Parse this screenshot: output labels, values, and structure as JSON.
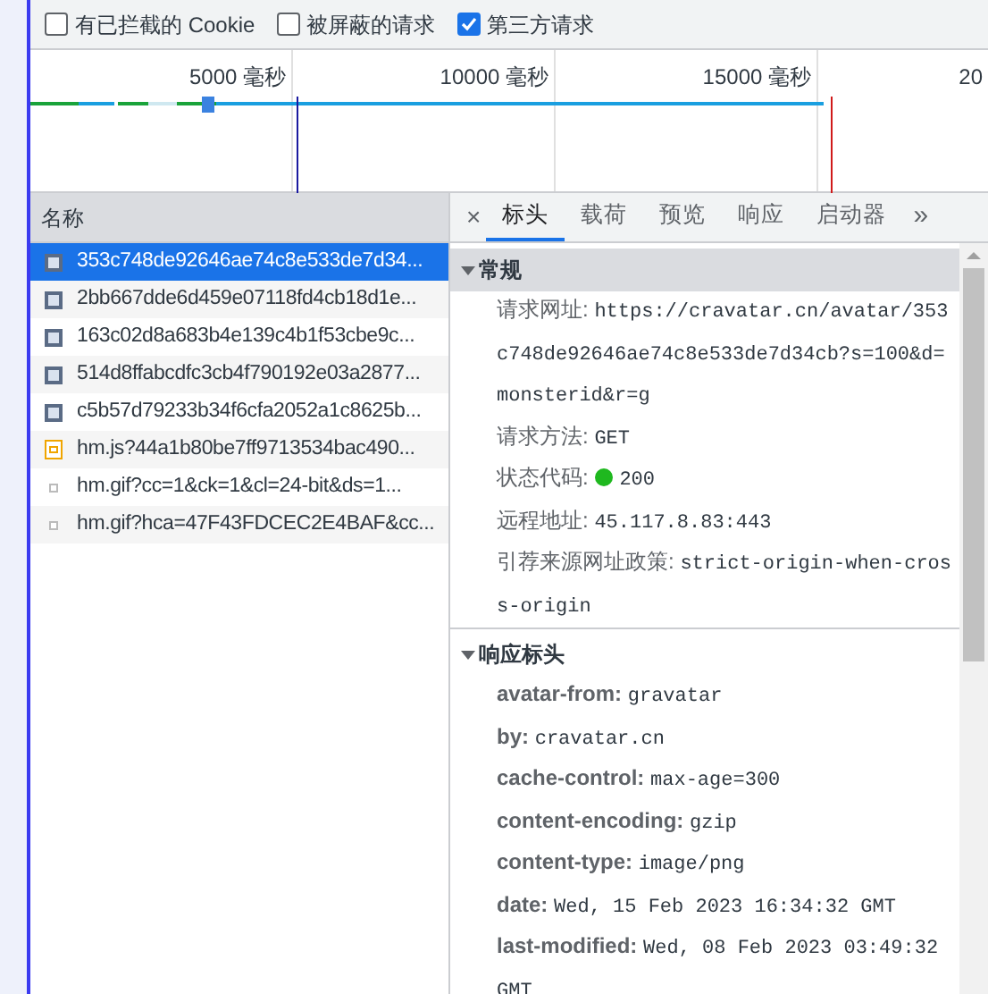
{
  "filters": [
    {
      "label": "有已拦截的 Cookie",
      "checked": false
    },
    {
      "label": "被屏蔽的请求",
      "checked": false
    },
    {
      "label": "第三方请求",
      "checked": true
    }
  ],
  "timeline": {
    "ticks": [
      "5000 毫秒",
      "10000 毫秒",
      "15000 毫秒",
      "20"
    ]
  },
  "request_list": {
    "header": "名称",
    "rows": [
      {
        "name": "353c748de92646ae74c8e533de7d34...",
        "kind": "image",
        "selected": true
      },
      {
        "name": "2bb667dde6d459e07118fd4cb18d1e...",
        "kind": "image",
        "selected": false
      },
      {
        "name": "163c02d8a683b4e139c4b1f53cbe9c...",
        "kind": "image",
        "selected": false
      },
      {
        "name": "514d8ffabcdfc3cb4f790192e03a2877...",
        "kind": "image",
        "selected": false
      },
      {
        "name": "c5b57d79233b34f6cfa2052a1c8625b...",
        "kind": "image",
        "selected": false
      },
      {
        "name": "hm.js?44a1b80be7ff9713534bac490...",
        "kind": "script",
        "selected": false
      },
      {
        "name": "hm.gif?cc=1&ck=1&cl=24-bit&ds=1...",
        "kind": "gif",
        "selected": false
      },
      {
        "name": "hm.gif?hca=47F43FDCEC2E4BAF&cc...",
        "kind": "gif",
        "selected": false
      }
    ]
  },
  "detail": {
    "close": "×",
    "more": "»",
    "tabs": [
      {
        "label": "标头",
        "selected": true
      },
      {
        "label": "载荷",
        "selected": false
      },
      {
        "label": "预览",
        "selected": false
      },
      {
        "label": "响应",
        "selected": false
      },
      {
        "label": "启动器",
        "selected": false
      }
    ],
    "sections": [
      {
        "title": "常规",
        "expanded": true,
        "rows": [
          {
            "key": "请求网址:",
            "value": "https://cravatar.cn/avatar/353c748de92646ae74c8e533de7d34cb?s=100&d=monsterid&r=g",
            "kind": "text"
          },
          {
            "key": "请求方法:",
            "value": "GET",
            "kind": "text"
          },
          {
            "key": "状态代码:",
            "value": "200",
            "kind": "status"
          },
          {
            "key": "远程地址:",
            "value": "45.117.8.83:443",
            "kind": "text"
          },
          {
            "key": "引荐来源网址政策:",
            "value": "strict-origin-when-cross-origin",
            "kind": "text"
          }
        ]
      },
      {
        "title": "响应标头",
        "expanded": true,
        "rows": [
          {
            "key": "avatar-from:",
            "value": "gravatar",
            "kind": "text"
          },
          {
            "key": "by:",
            "value": "cravatar.cn",
            "kind": "text"
          },
          {
            "key": "cache-control:",
            "value": "max-age=300",
            "kind": "text"
          },
          {
            "key": "content-encoding:",
            "value": "gzip",
            "kind": "text"
          },
          {
            "key": "content-type:",
            "value": "image/png",
            "kind": "text"
          },
          {
            "key": "date:",
            "value": "Wed, 15 Feb 2023 16:34:32 GMT",
            "kind": "text"
          },
          {
            "key": "last-modified:",
            "value": "Wed, 08 Feb 2023 03:49:32 GMT",
            "kind": "text"
          }
        ]
      }
    ]
  }
}
